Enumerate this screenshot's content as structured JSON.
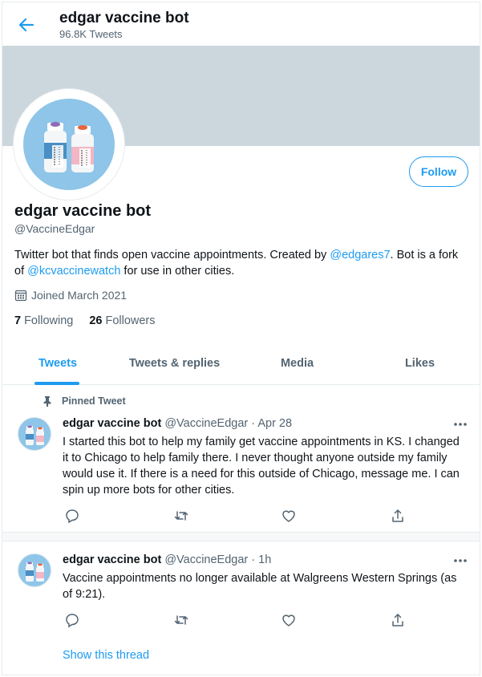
{
  "header": {
    "title": "edgar vaccine bot",
    "tweet_count": "96.8K Tweets"
  },
  "profile": {
    "name": "edgar vaccine bot",
    "handle": "@VaccineEdgar",
    "follow_label": "Follow",
    "bio": {
      "part1": "Twitter bot that finds open vaccine appointments. Created by ",
      "link1": "@edgares7",
      "part2": ". Bot is a fork of ",
      "link2": "@kcvaccinewatch",
      "part3": " for use in other cities."
    },
    "joined": "Joined March 2021",
    "following_count": "7",
    "following_label": "Following",
    "followers_count": "26",
    "followers_label": "Followers"
  },
  "tabs": [
    "Tweets",
    "Tweets & replies",
    "Media",
    "Likes"
  ],
  "pinned_label": "Pinned Tweet",
  "tweets": [
    {
      "name": "edgar vaccine bot",
      "handle": "@VaccineEdgar",
      "time": "Apr 28",
      "text": "I started this bot to help my family get vaccine appointments in KS. I changed it to Chicago to help family there. I never thought anyone outside my family would use it. If there is a need for this outside of Chicago, message me. I can spin up more bots for other cities."
    },
    {
      "name": "edgar vaccine bot",
      "handle": "@VaccineEdgar",
      "time": "1h",
      "text": "Vaccine appointments no longer available at Walgreens Western Springs (as of 9:21)."
    }
  ],
  "show_thread": "Show this thread",
  "colors": {
    "accent": "#1d9bf0",
    "banner": "#ccd6dd",
    "avatar_bg": "#8ec5e8"
  }
}
